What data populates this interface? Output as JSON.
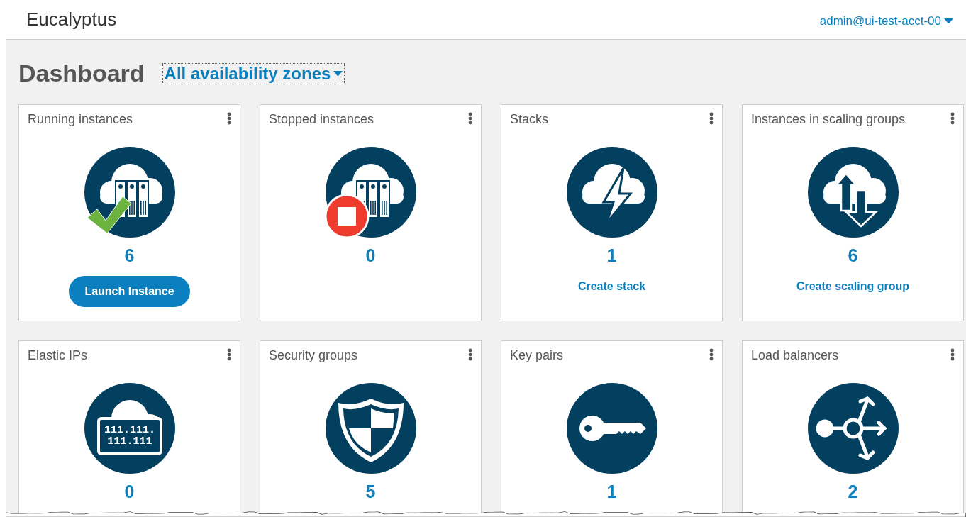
{
  "header": {
    "brand": "Eucalyptus",
    "user_menu": "admin@ui-test-acct-00"
  },
  "page": {
    "title": "Dashboard",
    "zone_selector": "All availability zones"
  },
  "cards": [
    {
      "title": "Running instances",
      "kind": "running",
      "count": "6",
      "action": {
        "kind": "button",
        "label": "Launch Instance"
      }
    },
    {
      "title": "Stopped instances",
      "kind": "stopped",
      "count": "0"
    },
    {
      "title": "Stacks",
      "kind": "stacks",
      "count": "1",
      "action": {
        "kind": "link",
        "label": "Create stack"
      }
    },
    {
      "title": "Instances in scaling groups",
      "kind": "scaling",
      "count": "6",
      "action": {
        "kind": "link",
        "label": "Create scaling group"
      }
    },
    {
      "title": "Elastic IPs",
      "kind": "eip",
      "icon_text": [
        "111.111.",
        "111.111"
      ],
      "count": "0"
    },
    {
      "title": "Security groups",
      "kind": "security",
      "count": "5"
    },
    {
      "title": "Key pairs",
      "kind": "key",
      "count": "1"
    },
    {
      "title": "Load balancers",
      "kind": "lb",
      "count": "2"
    }
  ]
}
